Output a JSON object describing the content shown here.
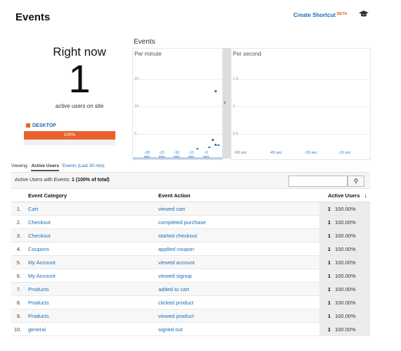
{
  "header": {
    "title": "Events",
    "create_shortcut": "Create Shortcut",
    "beta": "BETA",
    "hat_icon": "graduation-cap-icon"
  },
  "right_now": {
    "label": "Right now",
    "count": "1",
    "sublabel": "active users on site",
    "device_label": "DESKTOP",
    "device_pct": "100%",
    "device_fraction": 1.0,
    "accent": "#e8632b"
  },
  "events_chart": {
    "title": "Events",
    "per_minute": {
      "label": "Per minute",
      "y_ticks": [
        "15",
        "10",
        "5"
      ],
      "x_labels": [
        {
          "top": "-26",
          "bottom": "min"
        },
        {
          "top": "-21",
          "bottom": "min"
        },
        {
          "top": "-16",
          "bottom": "min"
        },
        {
          "top": "-11",
          "bottom": "min"
        },
        {
          "top": "-6",
          "bottom": "min"
        }
      ]
    },
    "per_second": {
      "label": "Per second",
      "y_ticks": [
        "1.5",
        "1",
        "0.5"
      ],
      "x_labels": [
        "-60 sec",
        "-45 sec",
        "-30 sec",
        "-15 sec"
      ]
    },
    "series_color": "#3c7ac2"
  },
  "viewing": {
    "label": "Viewing:",
    "active_tab": "Active Users",
    "other_tab": "Events (Last 30 min)"
  },
  "summary": {
    "prefix": "Active Users with Events:",
    "count": "1",
    "pct": "(100% of total)"
  },
  "table": {
    "columns": [
      "Event Category",
      "Event Action",
      "Active Users"
    ],
    "rows": [
      {
        "n": "1.",
        "category": "Cart",
        "action": "viewed cart",
        "users": "1",
        "pct": "100.00%"
      },
      {
        "n": "2.",
        "category": "Checkout",
        "action": "completed purchase",
        "users": "1",
        "pct": "100.00%"
      },
      {
        "n": "3.",
        "category": "Checkout",
        "action": "started checkout",
        "users": "1",
        "pct": "100.00%"
      },
      {
        "n": "4.",
        "category": "Coupons",
        "action": "applied coupon",
        "users": "1",
        "pct": "100.00%"
      },
      {
        "n": "5.",
        "category": "My Account",
        "action": "viewed account",
        "users": "1",
        "pct": "100.00%"
      },
      {
        "n": "6.",
        "category": "My Account",
        "action": "viewed signup",
        "users": "1",
        "pct": "100.00%"
      },
      {
        "n": "7.",
        "category": "Products",
        "action": "added to cart",
        "users": "1",
        "pct": "100.00%"
      },
      {
        "n": "8.",
        "category": "Products",
        "action": "clicked product",
        "users": "1",
        "pct": "100.00%"
      },
      {
        "n": "9.",
        "category": "Products",
        "action": "viewed product",
        "users": "1",
        "pct": "100.00%"
      },
      {
        "n": "10.",
        "category": "general",
        "action": "signed out",
        "users": "1",
        "pct": "100.00%"
      }
    ]
  }
}
